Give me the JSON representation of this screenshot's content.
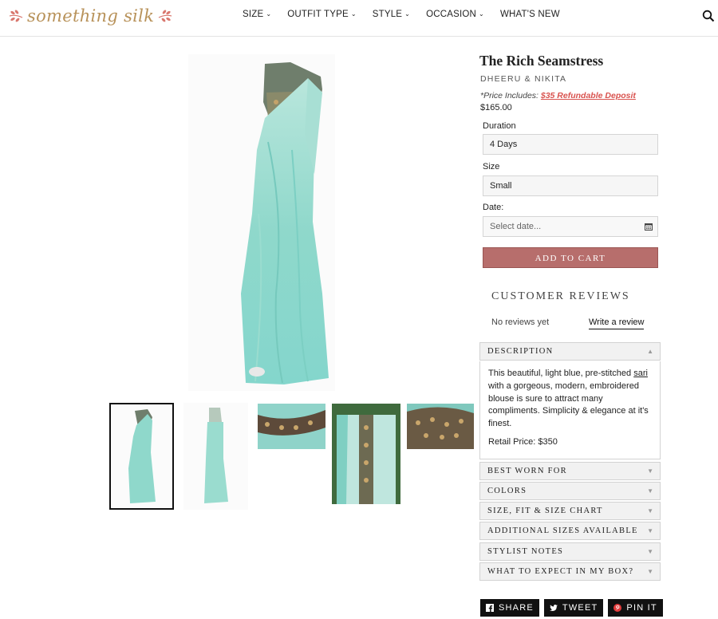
{
  "header": {
    "logo_text": "something silk",
    "nav": [
      {
        "label": "SIZE",
        "has_dropdown": true
      },
      {
        "label": "OUTFIT TYPE",
        "has_dropdown": true
      },
      {
        "label": "STYLE",
        "has_dropdown": true
      },
      {
        "label": "OCCASION",
        "has_dropdown": true
      },
      {
        "label": "WHAT'S NEW",
        "has_dropdown": false
      }
    ],
    "search_icon": "search-icon"
  },
  "product": {
    "title": "The Rich Seamstress",
    "vendor": "DHEERU & NIKITA",
    "price_note_prefix": "*Price Includes: ",
    "price_note_link": "$35 Refundable Deposit",
    "price": "$165.00",
    "duration_label": "Duration",
    "duration_value": "4 Days",
    "size_label": "Size",
    "size_value": "Small",
    "date_label": "Date:",
    "date_placeholder": "Select date...",
    "add_to_cart": "ADD TO CART"
  },
  "reviews": {
    "title": "CUSTOMER REVIEWS",
    "empty_text": "No reviews yet",
    "write_link": "Write a review"
  },
  "accordion": {
    "description": {
      "title": "DESCRIPTION",
      "text_1": "This beautiful, light blue, pre-stitched ",
      "text_link": "sari",
      "text_2": " with a gorgeous, modern, embroidered blouse is sure to attract many compliments. Simplicity & elegance at it's finest.",
      "retail": "Retail Price: $350"
    },
    "sections": [
      "BEST WORN FOR",
      "COLORS",
      "SIZE, FIT & SIZE CHART",
      "ADDITIONAL SIZES AVAILABLE",
      "STYLIST NOTES",
      "WHAT TO EXPECT IN MY BOX?"
    ]
  },
  "share": {
    "share": "SHARE",
    "tweet": "TWEET",
    "pin": "PIN IT"
  },
  "colors": {
    "accent": "#b76e6c",
    "link_red": "#d9534f",
    "logo_gold": "#b8925a",
    "sari_teal": "#8fd3c9"
  }
}
